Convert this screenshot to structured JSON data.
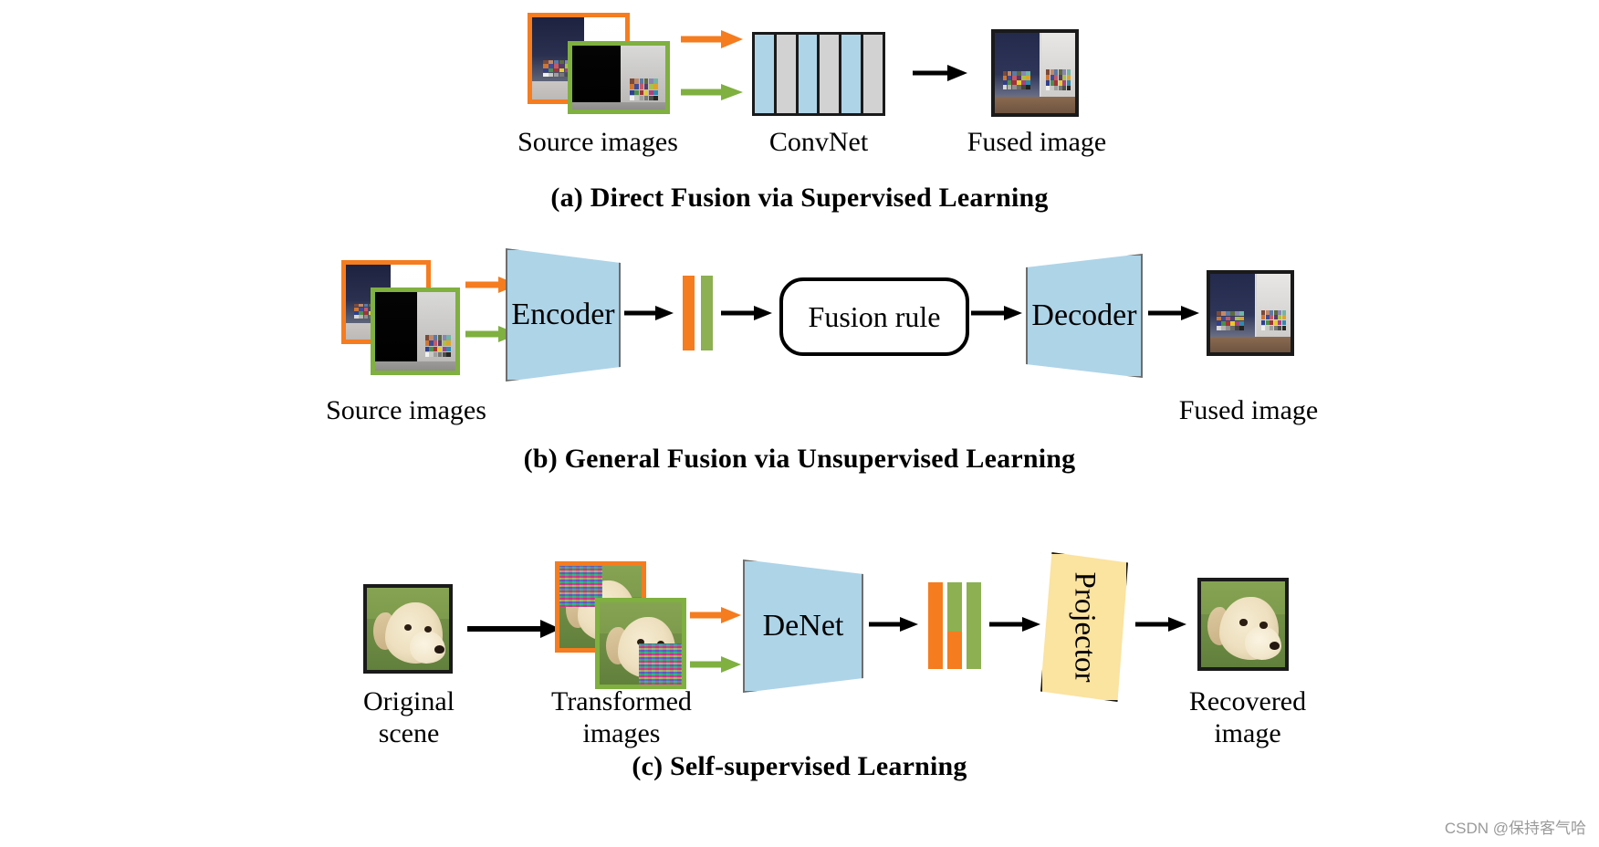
{
  "figure": {
    "panels": [
      {
        "id": "a",
        "caption": "(a) Direct Fusion via Supervised Learning",
        "labels": {
          "source": "Source images",
          "network": "ConvNet",
          "output": "Fused image"
        },
        "network_block": {
          "name": "ConvNet",
          "stripe_count": 6,
          "stripe_colors": [
            "#aed4e8",
            "#d2d2d2",
            "#aed4e8",
            "#d2d2d2",
            "#aed4e8",
            "#d2d2d2"
          ],
          "border_color": "#1a1a1a"
        },
        "arrows": [
          {
            "name": "orange-input-arrow",
            "color": "#f57c1f"
          },
          {
            "name": "green-input-arrow",
            "color": "#7fb040"
          },
          {
            "name": "output-arrow",
            "color": "#000000"
          }
        ]
      },
      {
        "id": "b",
        "caption": "(b) General Fusion via Unsupervised Learning",
        "labels": {
          "source": "Source images",
          "encoder": "Encoder",
          "fusion_rule": "Fusion rule",
          "decoder": "Decoder",
          "output": "Fused image"
        },
        "feature_bars": [
          {
            "name": "orange-feature-bar",
            "color": "#f57c1f"
          },
          {
            "name": "green-feature-bar",
            "color": "#8cb052"
          }
        ],
        "arrows": [
          {
            "name": "orange-input-arrow",
            "color": "#f57c1f"
          },
          {
            "name": "green-input-arrow",
            "color": "#7fb040"
          },
          {
            "name": "encoder-to-features-arrow",
            "color": "#000000"
          },
          {
            "name": "features-to-fusion-arrow",
            "color": "#000000"
          },
          {
            "name": "fusion-to-decoder-arrow",
            "color": "#000000"
          },
          {
            "name": "decoder-to-output-arrow",
            "color": "#000000"
          }
        ]
      },
      {
        "id": "c",
        "caption": "(c) Self-supervised Learning",
        "labels": {
          "original": "Original\nscene",
          "original_line1": "Original",
          "original_line2": "scene",
          "transformed_line1": "Transformed",
          "transformed_line2": "images",
          "network": "DeNet",
          "projector": "Projector",
          "recovered_line1": "Recovered",
          "recovered_line2": "image"
        },
        "feature_bars": [
          {
            "name": "orange-feature-bar",
            "color": "#f57c1f"
          },
          {
            "name": "green-over-orange-feature-bar",
            "top_color": "#8cb052",
            "bottom_color": "#f57c1f"
          },
          {
            "name": "green-feature-bar",
            "color": "#8cb052"
          }
        ],
        "arrows": [
          {
            "name": "original-to-transformed-arrow",
            "color": "#000000"
          },
          {
            "name": "orange-input-arrow",
            "color": "#f57c1f"
          },
          {
            "name": "green-input-arrow",
            "color": "#7fb040"
          },
          {
            "name": "denet-to-features-arrow",
            "color": "#000000"
          },
          {
            "name": "features-to-projector-arrow",
            "color": "#000000"
          },
          {
            "name": "projector-to-output-arrow",
            "color": "#000000"
          }
        ]
      }
    ],
    "palette": {
      "orange": "#f57c1f",
      "green": "#7fb040",
      "light_blue": "#aed4e8",
      "light_gray": "#d2d2d2",
      "yellow": "#fbe3a0",
      "black": "#000000"
    },
    "watermark": "CSDN @保持客气哈"
  }
}
